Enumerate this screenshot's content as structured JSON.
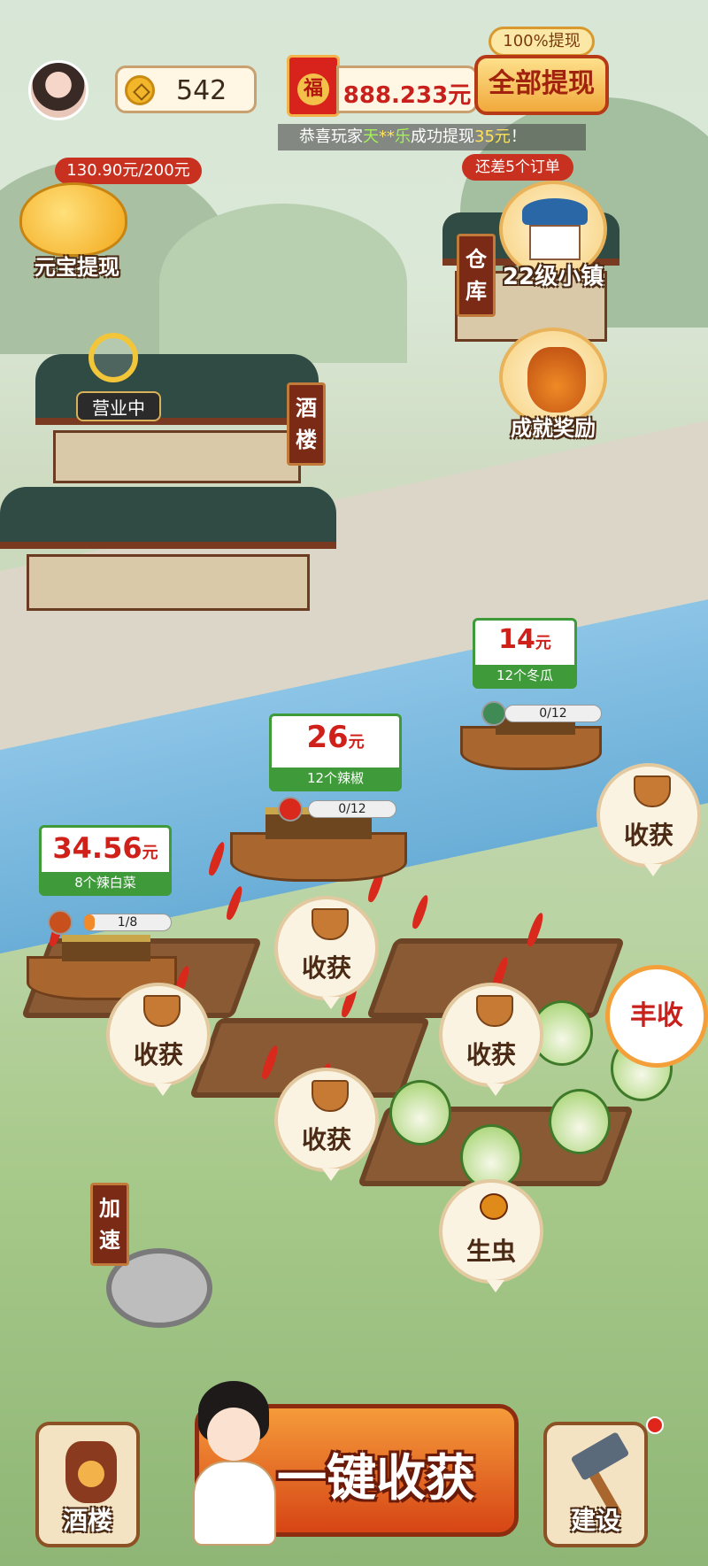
{
  "header": {
    "coins": "542",
    "money": "888.233元",
    "red_packet_char": "福",
    "withdraw_tag": "100%提现",
    "withdraw_button": "全部提现",
    "ticker_prefix": "恭喜玩家",
    "ticker_name_1": "天",
    "ticker_name_mask": "**",
    "ticker_name_2": "乐",
    "ticker_mid": "成功提现",
    "ticker_amount": "35元",
    "ticker_suffix": "！"
  },
  "piggy": {
    "progress": "130.90元/200元",
    "label": "元宝提现"
  },
  "town": {
    "tag": "还差5个订单",
    "label": "22级小镇"
  },
  "achievement": {
    "label": "成就奖励"
  },
  "signs": {
    "warehouse": [
      "仓",
      "库"
    ],
    "tavern": [
      "酒",
      "楼"
    ],
    "speedup": [
      "加",
      "速"
    ]
  },
  "business_status": "营业中",
  "orders": [
    {
      "price": "14",
      "unit": "元",
      "desc": "12个冬瓜",
      "progress": "0/12",
      "fill": 0
    },
    {
      "price": "26",
      "unit": "元",
      "desc": "12个辣椒",
      "progress": "0/12",
      "fill": 0
    },
    {
      "price": "34.56",
      "unit": "元",
      "desc": "8个辣白菜",
      "progress": "1/8",
      "fill": 0.125
    }
  ],
  "bubbles": {
    "harvest": "收获",
    "bug": "生虫",
    "bumper": "丰收"
  },
  "bottom": {
    "tavern": "酒楼",
    "tavern_mark": "酒",
    "harvest_all": "一键收获",
    "build": "建设"
  },
  "colors": {
    "accent_red": "#c8201b",
    "order_green": "#3f9a3a",
    "gold": "#f3b62a"
  }
}
